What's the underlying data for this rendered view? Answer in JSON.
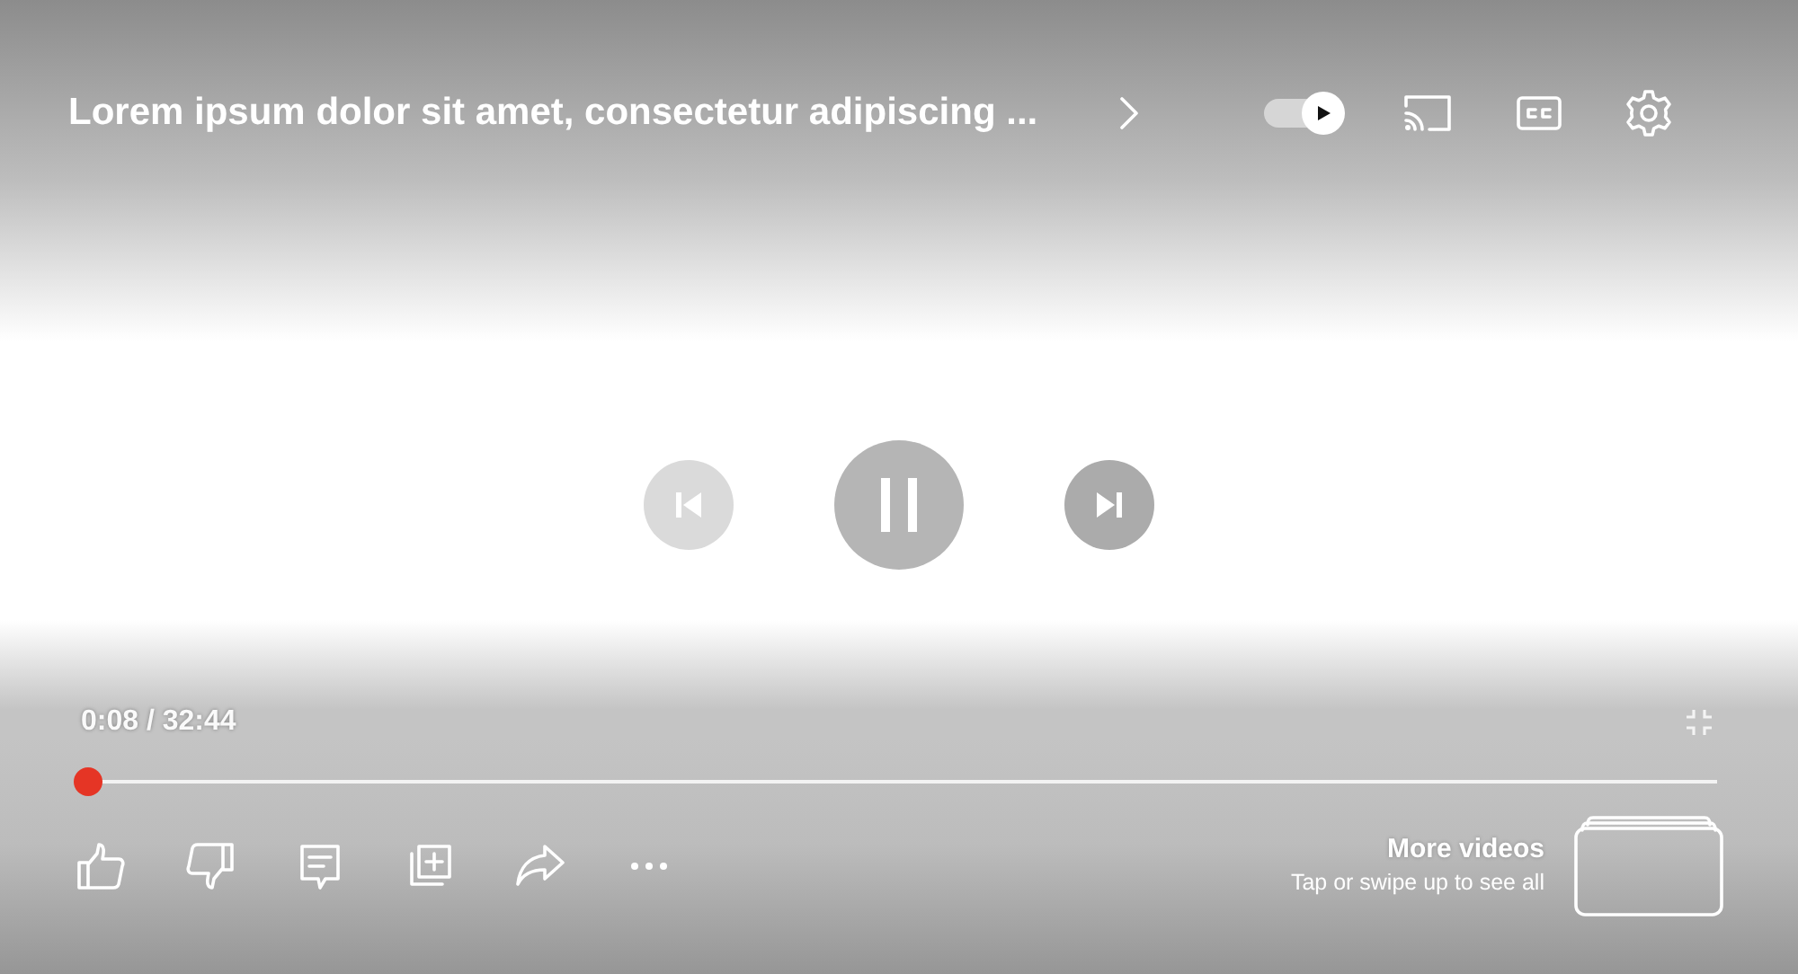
{
  "title": "Lorem ipsum dolor sit amet, consectetur adipiscing ...",
  "autoplay": {
    "on": true
  },
  "transport": [
    {
      "kind": "previous",
      "disabled": true
    },
    {
      "kind": "pause",
      "disabled": false
    },
    {
      "kind": "next",
      "disabled": false
    }
  ],
  "time": "0:08 / 32:44",
  "progress": {
    "level": 0.004
  },
  "actions": [
    {
      "kind": "like"
    },
    {
      "kind": "dislike"
    },
    {
      "kind": "comment"
    },
    {
      "kind": "save"
    },
    {
      "kind": "share"
    },
    {
      "kind": "more"
    }
  ],
  "more_videos": {
    "title": "More videos",
    "subtitle": "Tap or swipe up to see all"
  }
}
